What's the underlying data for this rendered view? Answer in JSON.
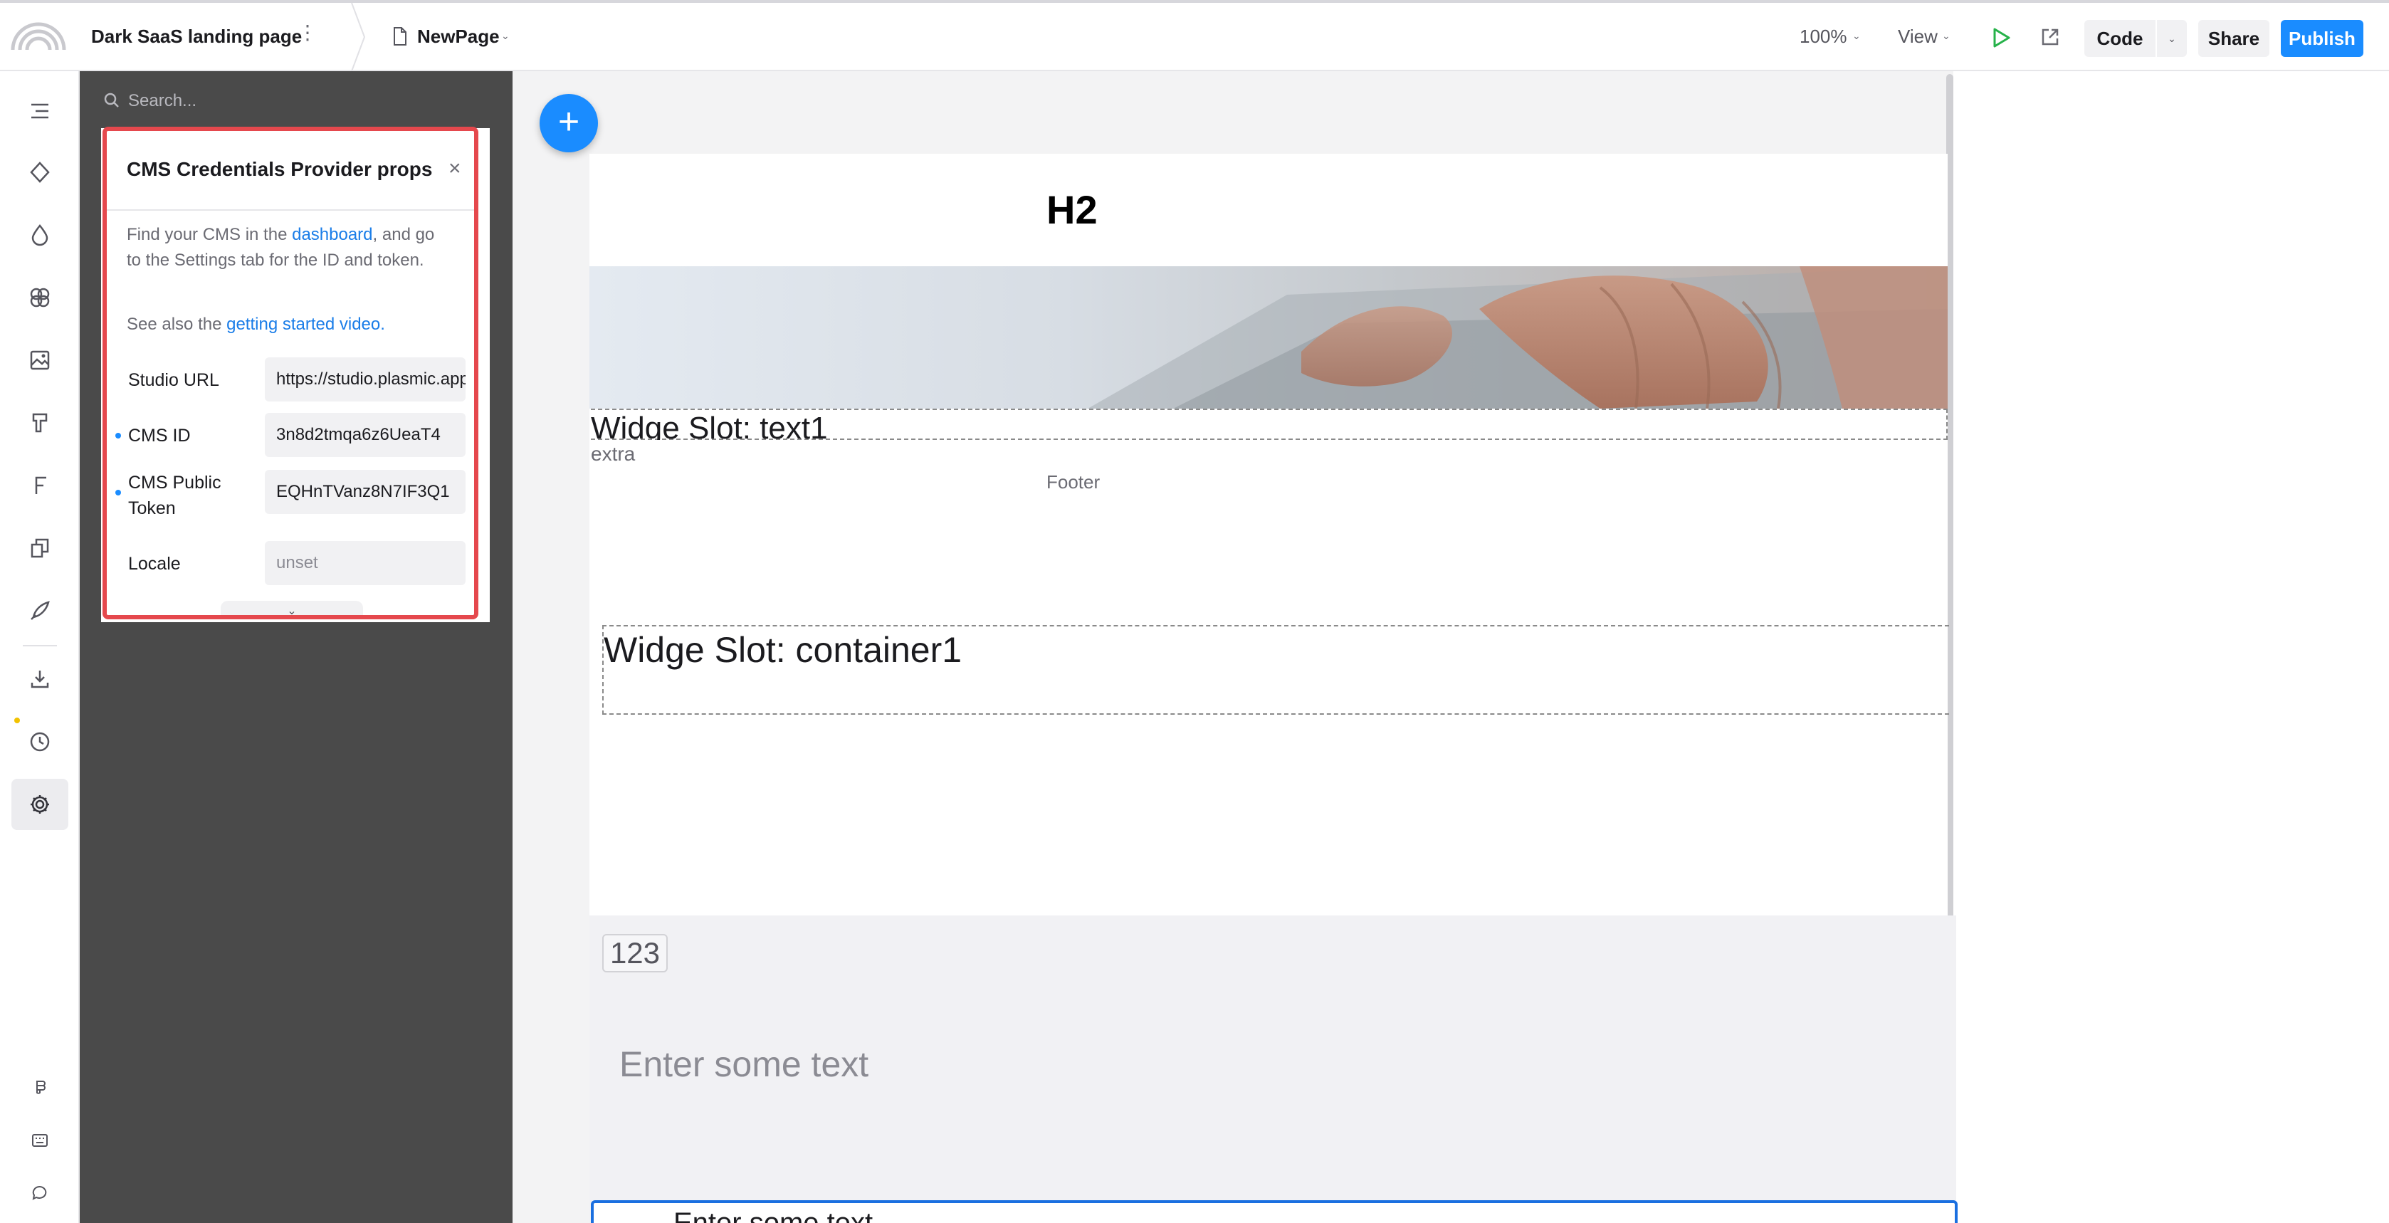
{
  "topbar": {
    "project_title": "Dark SaaS landing page",
    "page_name": "NewPage",
    "zoom": "100%",
    "view_label": "View",
    "code_label": "Code",
    "share_label": "Share",
    "publish_label": "Publish"
  },
  "rail": {
    "icons": [
      "outline-icon",
      "components-icon",
      "tokens-icon",
      "assets-icon",
      "images-icon",
      "data-icon",
      "fonts-icon",
      "pages-icon",
      "publish-icon",
      "imports-icon",
      "history-icon",
      "settings-icon",
      "figma-icon",
      "keyboard-icon",
      "chat-icon"
    ]
  },
  "leftpanel": {
    "search_placeholder": "Search..."
  },
  "props_popover": {
    "title": "CMS Credentials Provider props",
    "desc_prefix": "Find your CMS in the ",
    "desc_link": "dashboard",
    "desc_suffix": ", and go to the Settings tab for the ID and token.",
    "see_also_prefix": "See also the ",
    "see_also_link": "getting started video",
    "see_also_suffix": ".",
    "fields": [
      {
        "label": "Studio URL",
        "value": "https://studio.plasmic.app",
        "set": false
      },
      {
        "label": "CMS ID",
        "value": "3n8d2tmqa6z6UeaT4",
        "set": true
      },
      {
        "label": "CMS Public Token",
        "value": "EQHnTVanz8N7IF3Q1",
        "set": true
      },
      {
        "label": "Locale",
        "value": "unset",
        "set": false
      }
    ]
  },
  "canvas": {
    "heading": "H2",
    "slot_text_label": "Widge Slot: text1",
    "extra_label": "extra",
    "footer_label": "Footer",
    "slot_container_label": "Widge Slot: container1",
    "counter_value": "123",
    "enter_text": "Enter some text",
    "input_text": "Enter some text"
  },
  "colors": {
    "accent": "#1a8cff",
    "highlight_border": "#e5484d",
    "side_panel": "#4a4a4a"
  }
}
